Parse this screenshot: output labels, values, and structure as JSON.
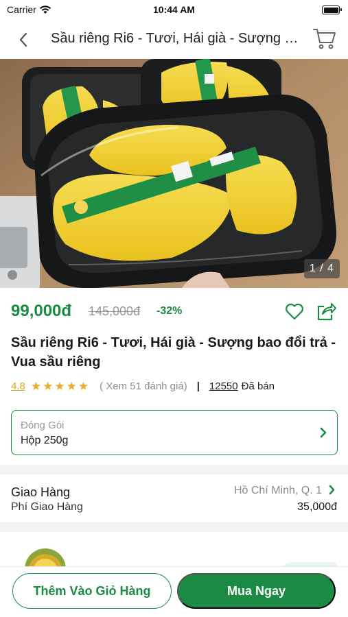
{
  "status_bar": {
    "carrier": "Carrier",
    "time": "10:44 AM",
    "battery_level": 1.0
  },
  "nav": {
    "title": "Sầu riêng Ri6 - Tươi, Hái già - Sượng bao đổi trả - Vua sầu riêng",
    "back_icon": "chevron-left-icon",
    "cart_icon": "cart-icon"
  },
  "gallery": {
    "counter": "1 / 4",
    "current_index": 1,
    "total": 4
  },
  "pricing": {
    "price": "99,000đ",
    "original_price": "145,000đ",
    "discount": "-32%",
    "favorite_icon": "heart-icon",
    "share_icon": "share-icon"
  },
  "product": {
    "title": "Sầu riêng Ri6 - Tươi, Hái già - Sượng bao đổi trả - Vua sầu riêng"
  },
  "rating": {
    "value": "4.8",
    "stars": 5,
    "reviews": "( Xem 51 đánh giá)",
    "separator": "|",
    "sold_count": "12550",
    "sold_label": "Đã bán"
  },
  "variant": {
    "label": "Đóng Gói",
    "value": "Hộp 250g"
  },
  "shipping": {
    "title": "Giao Hàng",
    "fee_label": "Phí Giao Hàng",
    "location": "Hồ Chí Minh, Q. 1",
    "fee": "35,000đ"
  },
  "actions": {
    "add_to_cart": "Thêm Vào Giỏ Hàng",
    "buy_now": "Mua Ngay"
  },
  "colors": {
    "brand_green": "#1b8a43",
    "star_orange": "#f0a92c",
    "muted_text": "#9a9a9a"
  }
}
